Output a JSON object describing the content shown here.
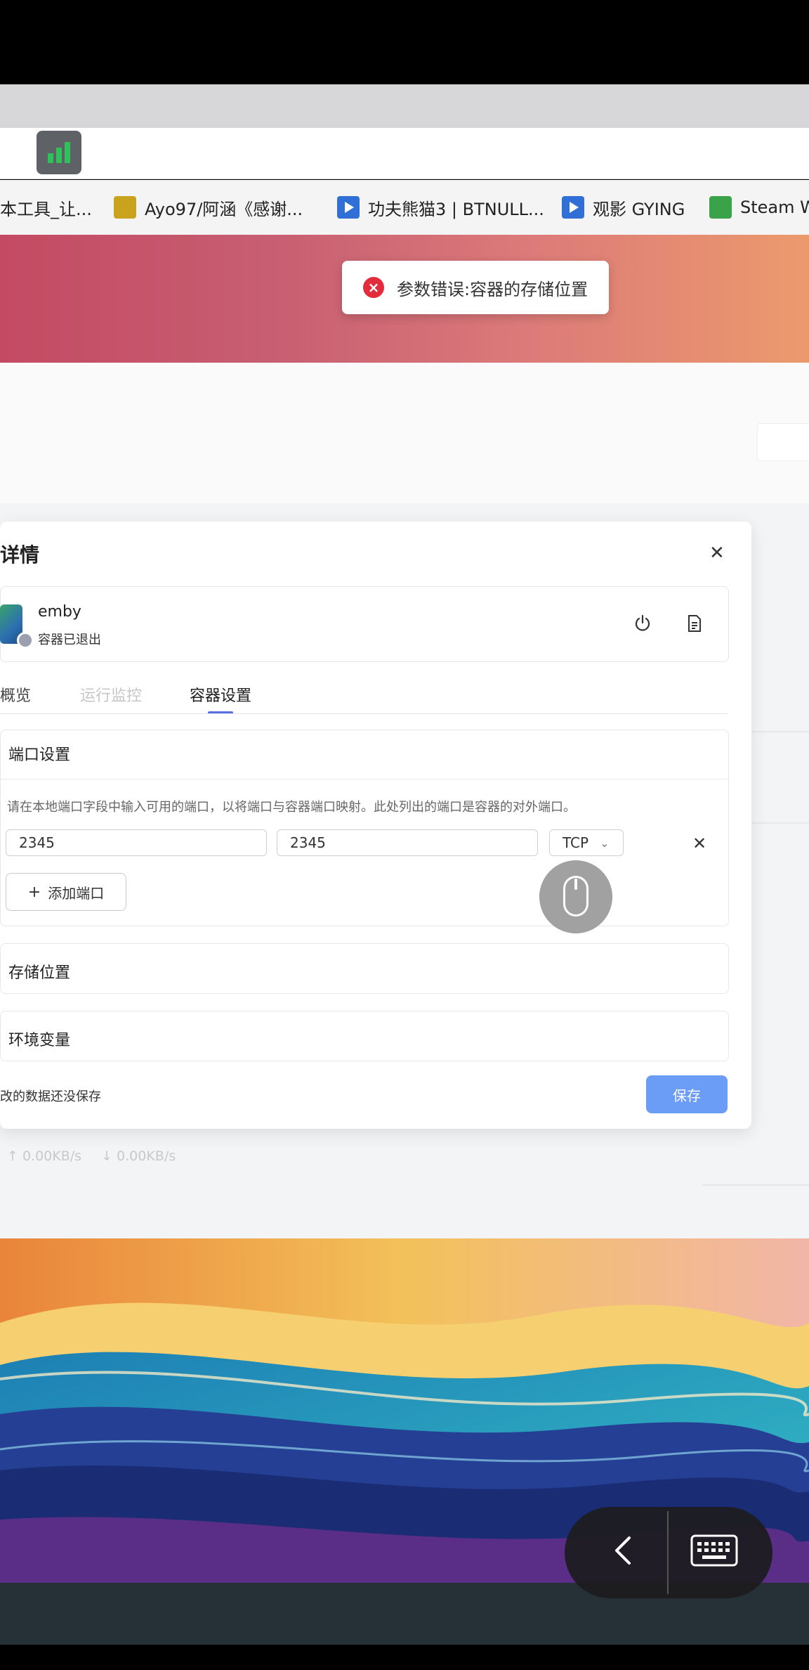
{
  "bookmarks": [
    {
      "label": "本工具_让...",
      "icon": "folder-icon"
    },
    {
      "label": "Ayo97/阿涵《感谢...",
      "icon": "emoji-icon"
    },
    {
      "label": "功夫熊猫3 | BTNULL...",
      "icon": "video-icon"
    },
    {
      "label": "观影 GYING",
      "icon": "video-icon"
    },
    {
      "label": "Steam W",
      "icon": "steam-icon"
    }
  ],
  "toast": {
    "message": "参数错误:容器的存储位置",
    "icon": "error-icon",
    "color": "#e22b3b"
  },
  "modal": {
    "title": "详情",
    "container": {
      "name": "emby",
      "status": "容器已退出"
    },
    "tabs": [
      {
        "label": "概览",
        "active": false,
        "disabled": false
      },
      {
        "label": "运行监控",
        "active": false,
        "disabled": true
      },
      {
        "label": "容器设置",
        "active": true,
        "disabled": false
      }
    ],
    "port_section": {
      "title": "端口设置",
      "description": "请在本地端口字段中输入可用的端口，以将端口与容器端口映射。此处列出的端口是容器的对外端口。",
      "local_port": "2345",
      "container_port": "2345",
      "protocol": "TCP",
      "add_label": "添加端口"
    },
    "storage_title": "存储位置",
    "env_title": "环境变量",
    "unsaved_note": "改的数据还没保存",
    "save_label": "保存"
  },
  "page": {
    "upload_speed": "↑ 0.00KB/s",
    "download_speed": "↓ 0.00KB/s"
  },
  "colors": {
    "accent": "#5b6ee1",
    "save_button": "#6b9cf6",
    "app_icon_bars": "#2fc25b"
  }
}
